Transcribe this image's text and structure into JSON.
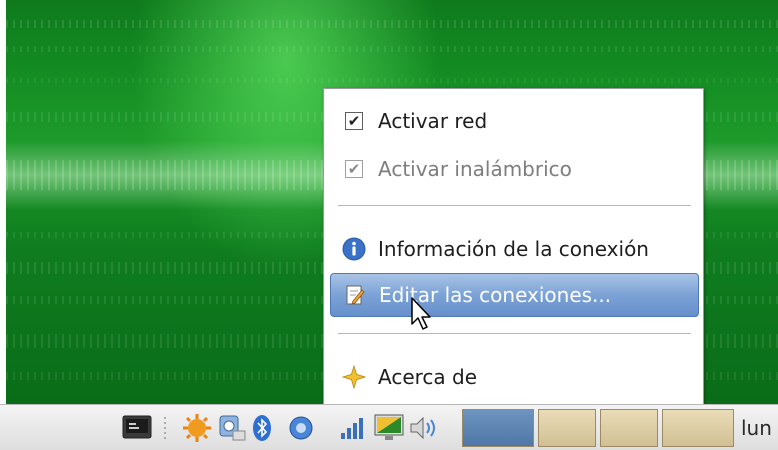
{
  "menu": {
    "items": [
      {
        "label": "Activar red",
        "checked": true,
        "enabled": true
      },
      {
        "label": "Activar inalámbrico",
        "checked": true,
        "enabled": false
      },
      {
        "label": "Información de la conexión",
        "icon": "info-icon"
      },
      {
        "label": "Editar las conexiones...",
        "icon": "edit-icon",
        "highlighted": true
      },
      {
        "label": "Acerca de",
        "icon": "star-icon"
      }
    ]
  },
  "taskbar": {
    "clock_text": "lun",
    "tray_icons": [
      "terminal-icon",
      "update-notifier-icon",
      "network-drive-icon",
      "bluetooth-icon",
      "network-signal-icon",
      "display-icon",
      "volume-icon"
    ]
  },
  "colors": {
    "desktop_green": "#148c22",
    "menu_highlight": "#7ca2d6",
    "separator": "#d3b08a",
    "info_blue": "#3a72c8",
    "star_gold": "#f0c030"
  }
}
